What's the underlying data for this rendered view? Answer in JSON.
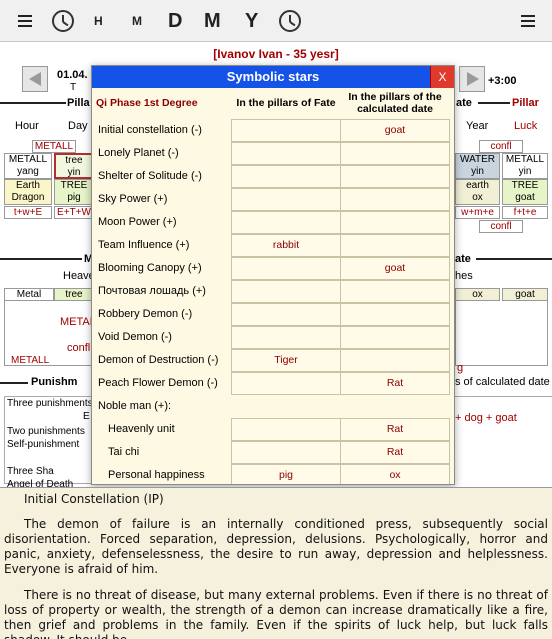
{
  "toolbar": {
    "left_menu": "menu",
    "buttons": [
      "H",
      "M",
      "D",
      "M",
      "Y"
    ],
    "right_menu": "menu"
  },
  "person": "[Ivanov Ivan - 35 yesr]",
  "date_fragment": "01.04.",
  "date_fragment2": "T",
  "tz": "+3:00",
  "bg": {
    "pillars_left": "Pilla",
    "pillars_right_frag": "ate",
    "pillar_right": "Pillar",
    "col_hour": "Hour",
    "col_day": "Day",
    "col_year": "Year",
    "col_luck": "Luck",
    "metall_top": "METALL",
    "confl_top": "confl",
    "left_cells": [
      "METALL",
      "yang",
      "Earth",
      "Dragon",
      "t+w+E"
    ],
    "day_cells": [
      "tree",
      "yin",
      "TREE",
      "pig",
      "E+T+W"
    ],
    "year_cells": [
      "WATER",
      "yin",
      "earth",
      "ox",
      "w+m+e"
    ],
    "luck_cells": [
      "METALL",
      "yin",
      "TREE",
      "goat",
      "f+t+e"
    ],
    "confl_mid": "confl",
    "m_frag": "M",
    "heave_frag": "Heave",
    "ate_frag2": "ate",
    "hes_frag": "hes",
    "metal": "Metal",
    "tree2": "tree",
    "ox2": "ox",
    "goat2": "goat",
    "metall_mid": "METALL",
    "confl_left": "confl",
    "metall_bottom": "METALL",
    "g_frag": "g",
    "punishment_frag": "Punishm",
    "calc_date_frag": "s of calculated date",
    "dog_goat": "+ dog + goat",
    "rows": [
      "Three punishments",
      "E",
      "Two punishments",
      "Self-punishment",
      "Three Sha",
      "Angel of Death"
    ]
  },
  "modal": {
    "title": "Symbolic stars",
    "close": "X",
    "headers": {
      "col0": "Qi Phase 1st Degree",
      "col1": "In the pillars of Fate",
      "col2": "In the pillars of the calculated date"
    },
    "rows": [
      {
        "label": "Initial constellation (-)",
        "fate": "",
        "calc": "goat"
      },
      {
        "label": "Lonely Planet (-)",
        "fate": "",
        "calc": ""
      },
      {
        "label": "Shelter of Solitude (-)",
        "fate": "",
        "calc": ""
      },
      {
        "label": "Sky Power (+)",
        "fate": "",
        "calc": ""
      },
      {
        "label": "Moon Power (+)",
        "fate": "",
        "calc": ""
      },
      {
        "label": "Team Influence (+)",
        "fate": "rabbit",
        "calc": ""
      },
      {
        "label": "Blooming Canopy (+)",
        "fate": "",
        "calc": "goat"
      },
      {
        "label": "Почтовая лошадь (+)",
        "fate": "",
        "calc": ""
      },
      {
        "label": "Robbery Demon (-)",
        "fate": "",
        "calc": ""
      },
      {
        "label": "Void Demon (-)",
        "fate": "",
        "calc": ""
      },
      {
        "label": "Demon of Destruction (-)",
        "fate": "Tiger",
        "calc": ""
      },
      {
        "label": "Peach Flower Demon (-)",
        "fate": "",
        "calc": "Rat"
      },
      {
        "label": "Noble man (+):",
        "fate": "",
        "calc": "",
        "group": true
      },
      {
        "label": "Heavenly unit",
        "fate": "",
        "calc": "Rat",
        "indent": true
      },
      {
        "label": "Tai chi",
        "fate": "",
        "calc": "Rat",
        "indent": true
      },
      {
        "label": "Personal happiness",
        "fate": "pig",
        "calc": "ox",
        "indent": true
      }
    ]
  },
  "description": {
    "title": "Initial Constellation (IP)",
    "p1": "The demon of failure is an internally conditioned press, subsequently social disorientation. Forced separation, depression, delusions. Psychologically, horror and panic, anxiety, defenselessness, the desire to run away, depression and helplessness. Everyone is afraid of him.",
    "p2": "There is no threat of disease, but many external problems. Even if there is no threat of loss of property or wealth, the strength of a demon can increase dramatically like a fire, then grief and problems in the family. Even if the spirits of luck help, but luck falls shadow. It should be"
  }
}
